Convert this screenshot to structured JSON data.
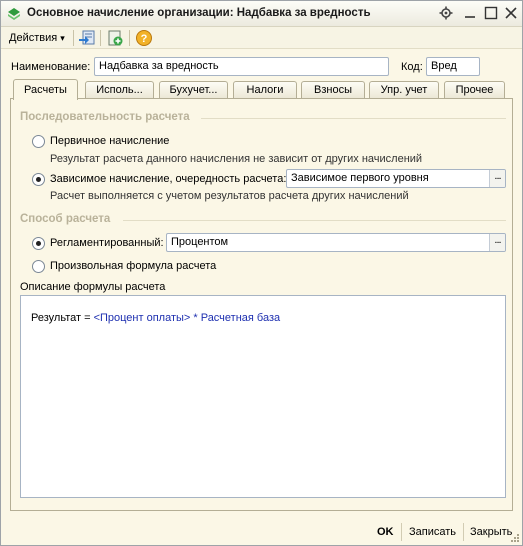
{
  "window": {
    "title": "Основное начисление организации: Надбавка за вредность"
  },
  "toolbar": {
    "actions_label": "Действия",
    "actions_arrow": "▾",
    "help_glyph": "?"
  },
  "header": {
    "name_label": "Наименование:",
    "name_value": "Надбавка за вредность",
    "code_label": "Код:",
    "code_value": "Вред"
  },
  "tabs": [
    {
      "label": "Расчеты",
      "active": true
    },
    {
      "label": "Исполь...",
      "active": false
    },
    {
      "label": "Бухучет...",
      "active": false
    },
    {
      "label": "Налоги",
      "active": false
    },
    {
      "label": "Взносы",
      "active": false
    },
    {
      "label": "Упр. учет",
      "active": false
    },
    {
      "label": "Прочее",
      "active": false
    }
  ],
  "sequence": {
    "title": "Последовательность расчета",
    "primary_label": "Первичное начисление",
    "primary_desc": "Результат расчета данного начисления не зависит от других начислений",
    "dependent_label": "Зависимое начисление, очередность расчета:",
    "dependent_value": "Зависимое первого уровня",
    "dependent_desc": "Расчет выполняется с учетом результатов расчета других начислений",
    "selected": "dependent"
  },
  "method": {
    "title": "Способ расчета",
    "regulated_label": "Регламентированный:",
    "regulated_value": "Процентом",
    "free_label": "Произвольная формула расчета",
    "selected": "regulated"
  },
  "formula": {
    "title": "Описание формулы расчета",
    "result": "Результат = ",
    "param": "<Процент оплаты>",
    "rest": " * Расчетная база"
  },
  "buttons": {
    "ok": "OK",
    "save": "Записать",
    "close": "Закрыть"
  },
  "colors": {
    "section_title": "#b9b29a",
    "formula_param": "#1d2fb0",
    "window_bg": "#fbf7e6"
  }
}
